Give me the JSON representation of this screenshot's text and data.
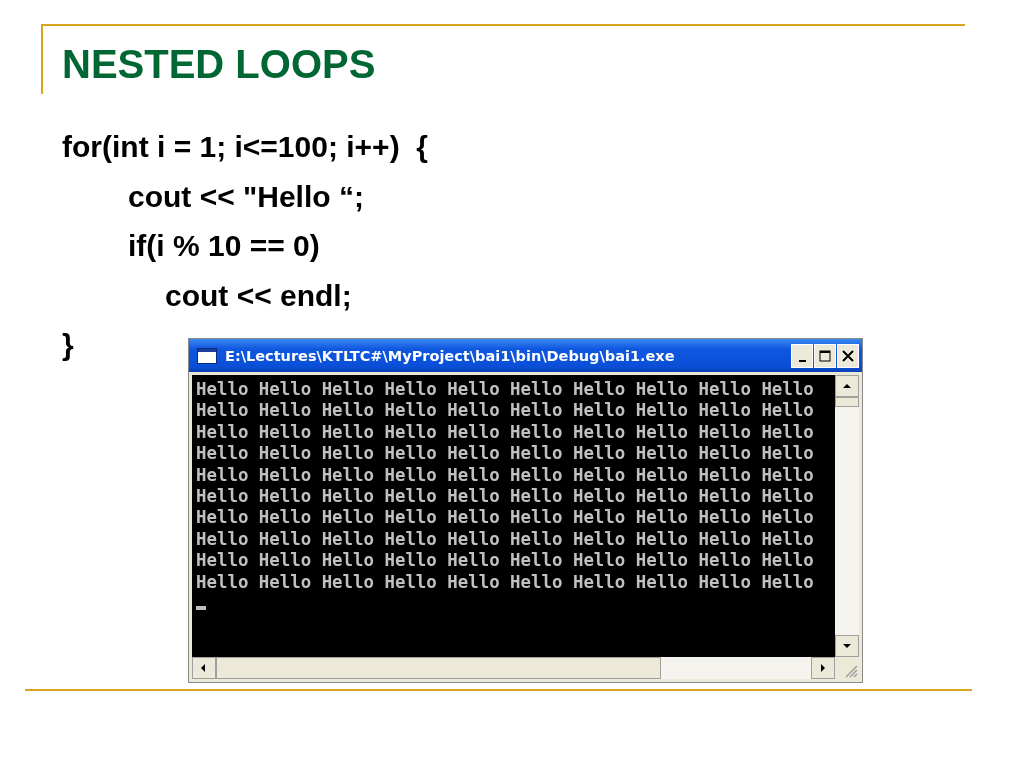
{
  "slide": {
    "title": "NESTED LOOPS",
    "code": [
      {
        "text": "for(int i = 1; i<=100; i++)  {",
        "children": [
          {
            "text": "cout << \"Hello “;"
          },
          {
            "text": "if(i % 10 == 0)",
            "children": [
              {
                "text": "cout << endl;"
              }
            ]
          }
        ]
      },
      {
        "text": "}"
      }
    ]
  },
  "console": {
    "title": "E:\\Lectures\\KTLTC#\\MyProject\\bai1\\bin\\Debug\\bai1.exe",
    "output": [
      "Hello Hello Hello Hello Hello Hello Hello Hello Hello Hello",
      "Hello Hello Hello Hello Hello Hello Hello Hello Hello Hello",
      "Hello Hello Hello Hello Hello Hello Hello Hello Hello Hello",
      "Hello Hello Hello Hello Hello Hello Hello Hello Hello Hello",
      "Hello Hello Hello Hello Hello Hello Hello Hello Hello Hello",
      "Hello Hello Hello Hello Hello Hello Hello Hello Hello Hello",
      "Hello Hello Hello Hello Hello Hello Hello Hello Hello Hello",
      "Hello Hello Hello Hello Hello Hello Hello Hello Hello Hello",
      "Hello Hello Hello Hello Hello Hello Hello Hello Hello Hello",
      "Hello Hello Hello Hello Hello Hello Hello Hello Hello Hello"
    ]
  }
}
